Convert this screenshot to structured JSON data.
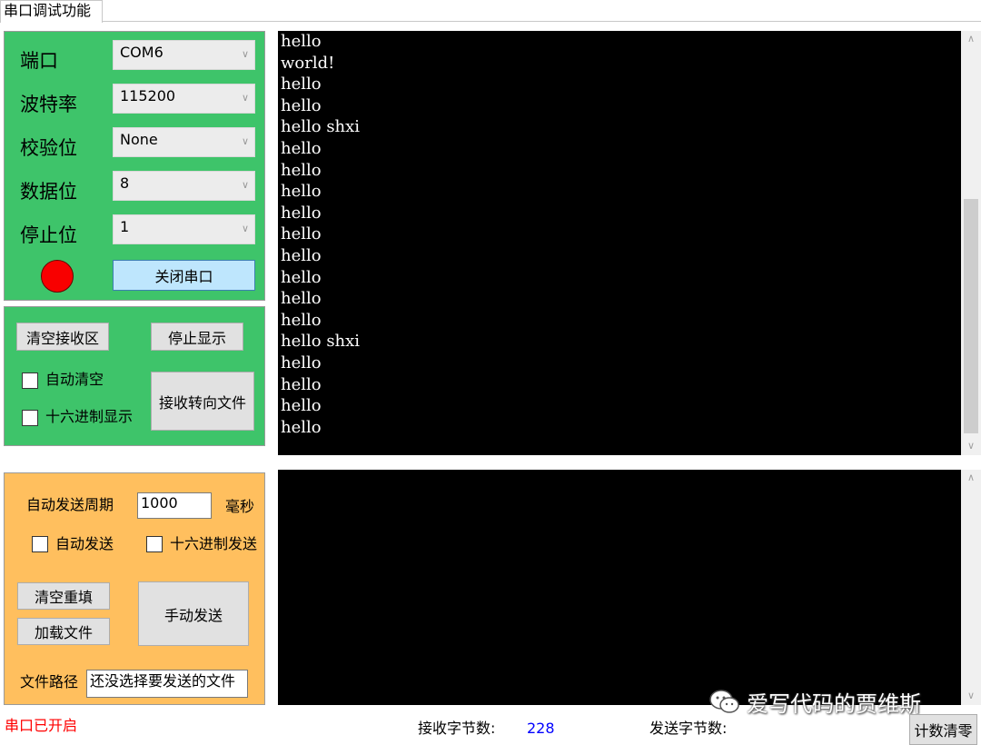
{
  "tab": {
    "label": "串口调试功能"
  },
  "port_settings": {
    "port_label": "端口",
    "port_value": "COM6",
    "baud_label": "波特率",
    "baud_value": "115200",
    "parity_label": "校验位",
    "parity_value": "None",
    "databits_label": "数据位",
    "databits_value": "8",
    "stopbits_label": "停止位",
    "stopbits_value": "1",
    "close_button": "关闭串口",
    "indicator_color": "#f80000"
  },
  "receive_controls": {
    "clear_button": "清空接收区",
    "stop_display_button": "停止显示",
    "auto_clear_label": "自动清空",
    "hex_display_label": "十六进制显示",
    "redirect_button": "接收转向文件"
  },
  "send_controls": {
    "period_label": "自动发送周期",
    "period_value": "1000",
    "period_unit": "毫秒",
    "auto_send_label": "自动发送",
    "hex_send_label": "十六进制发送",
    "clear_refill_button": "清空重填",
    "load_file_button": "加载文件",
    "manual_send_button": "手动发送",
    "file_path_label": "文件路径",
    "file_path_value": "还没选择要发送的文件"
  },
  "receive_area": {
    "lines": [
      "hello",
      "world!",
      "hello",
      "hello",
      "hello shxi",
      "hello",
      "hello",
      "hello",
      "hello",
      "hello",
      "hello",
      "hello",
      "hello",
      "hello",
      "hello shxi",
      "hello",
      "hello",
      "hello",
      "hello"
    ]
  },
  "send_area": {
    "text": ""
  },
  "watermark": {
    "text": "爱写代码的贾维斯",
    "icon": "wechat-icon"
  },
  "status_bar": {
    "port_status": "串口已开启",
    "received_label": "接收字节数:",
    "received_value": "228",
    "sent_label": "发送字节数:",
    "sent_value": "",
    "reset_button": "计数清零"
  },
  "colors": {
    "config_panel": "#3ec46a",
    "send_panel": "#ffbf5e",
    "status_open": "#ff0000",
    "count_value": "#0000ff",
    "terminal_bg": "#000000"
  }
}
